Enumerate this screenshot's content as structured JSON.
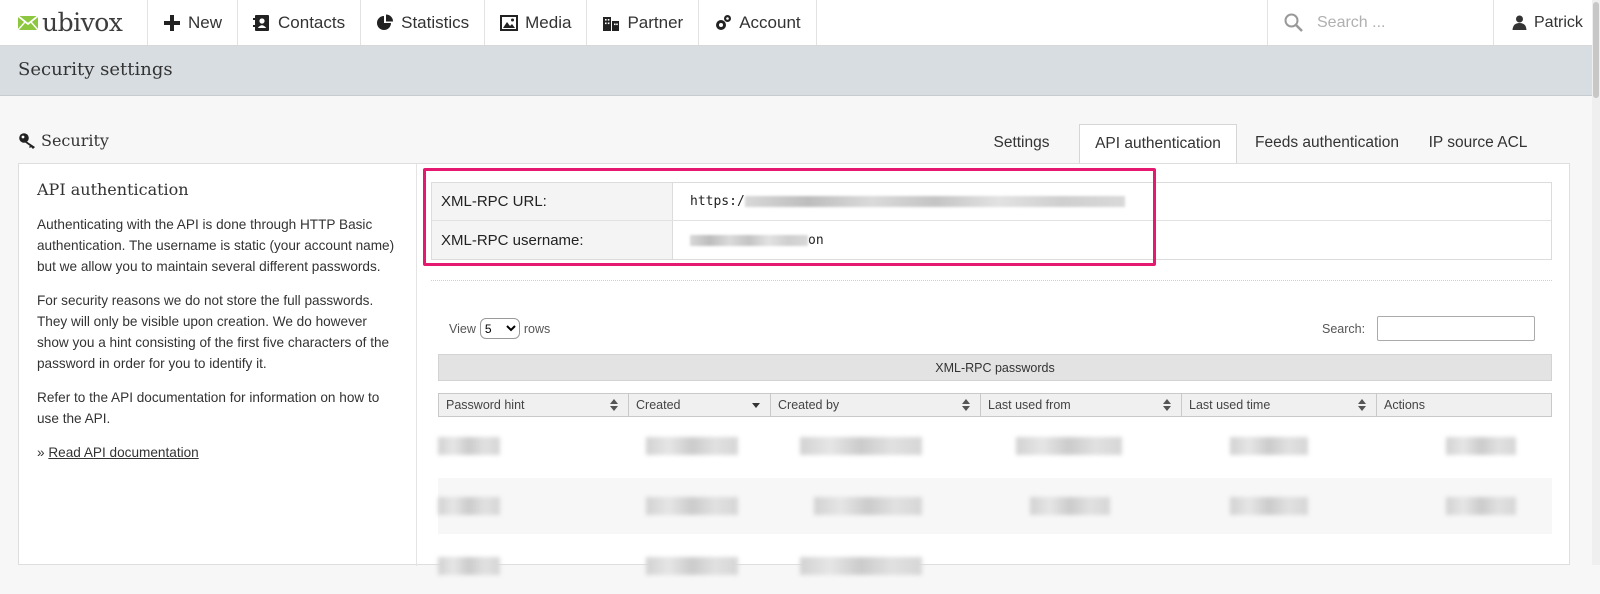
{
  "brand": {
    "name": "ubivox",
    "logo_icon": "envelope-logo-icon",
    "accent": "#8dc63f"
  },
  "nav": {
    "items": [
      {
        "label": "New",
        "icon": "plus-icon"
      },
      {
        "label": "Contacts",
        "icon": "address-book-icon"
      },
      {
        "label": "Statistics",
        "icon": "pie-chart-icon"
      },
      {
        "label": "Media",
        "icon": "image-icon"
      },
      {
        "label": "Partner",
        "icon": "building-icon"
      },
      {
        "label": "Account",
        "icon": "gears-icon"
      }
    ],
    "search_placeholder": "Search ...",
    "user": "Patrick"
  },
  "page": {
    "title": "Security settings"
  },
  "section": {
    "title": "Security",
    "icon": "key-icon"
  },
  "tabs": [
    {
      "label": "Settings",
      "active": false
    },
    {
      "label": "API authentication",
      "active": true
    },
    {
      "label": "Feeds authentication",
      "active": false
    },
    {
      "label": "IP source ACL",
      "active": false
    }
  ],
  "sidebar": {
    "heading": "API authentication",
    "p1": "Authenticating with the API is done through HTTP Basic authentication. The username is static (your account name) but we allow you to maintain several different passwords.",
    "p2": "For security reasons we do not store the full passwords. They will only be visible upon creation. We do however show you a hint consisting of the first five characters of the password in order for you to identify it.",
    "p3": "Refer to the API documentation for information on how to use the API.",
    "link_prefix": "» ",
    "link_label": "Read API documentation"
  },
  "credentials": {
    "url_label": "XML-RPC URL:",
    "url_value_visible": "https:/",
    "username_label": "XML-RPC username:",
    "username_value_visible": "on",
    "highlight_color": "#e5196f"
  },
  "datatable": {
    "view_label": "View",
    "rows_label": "rows",
    "page_size": "5",
    "search_label": "Search:",
    "caption": "XML-RPC passwords",
    "columns": [
      "Password hint",
      "Created",
      "Created by",
      "Last used from",
      "Last used time",
      "Actions"
    ],
    "sorted_column": "Created"
  }
}
